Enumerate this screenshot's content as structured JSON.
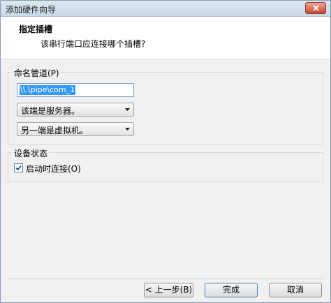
{
  "window": {
    "title": "添加硬件向导"
  },
  "header": {
    "title": "指定插槽",
    "subtitle": "该串行端口应连接哪个插槽?"
  },
  "pipe_group": {
    "legend": "命名管道(P)",
    "pipe_name_value": "\\\\.\\pipe\\com_1",
    "end_role_selected": "该端是服务器。",
    "other_end_selected": "另一端是虚拟机。"
  },
  "device_group": {
    "legend": "设备状态",
    "connect_on_start_label": "启动时连接(O)",
    "connect_on_start_checked": true
  },
  "buttons": {
    "back": "< 上一步(B)",
    "finish": "完成",
    "cancel": "取消"
  }
}
